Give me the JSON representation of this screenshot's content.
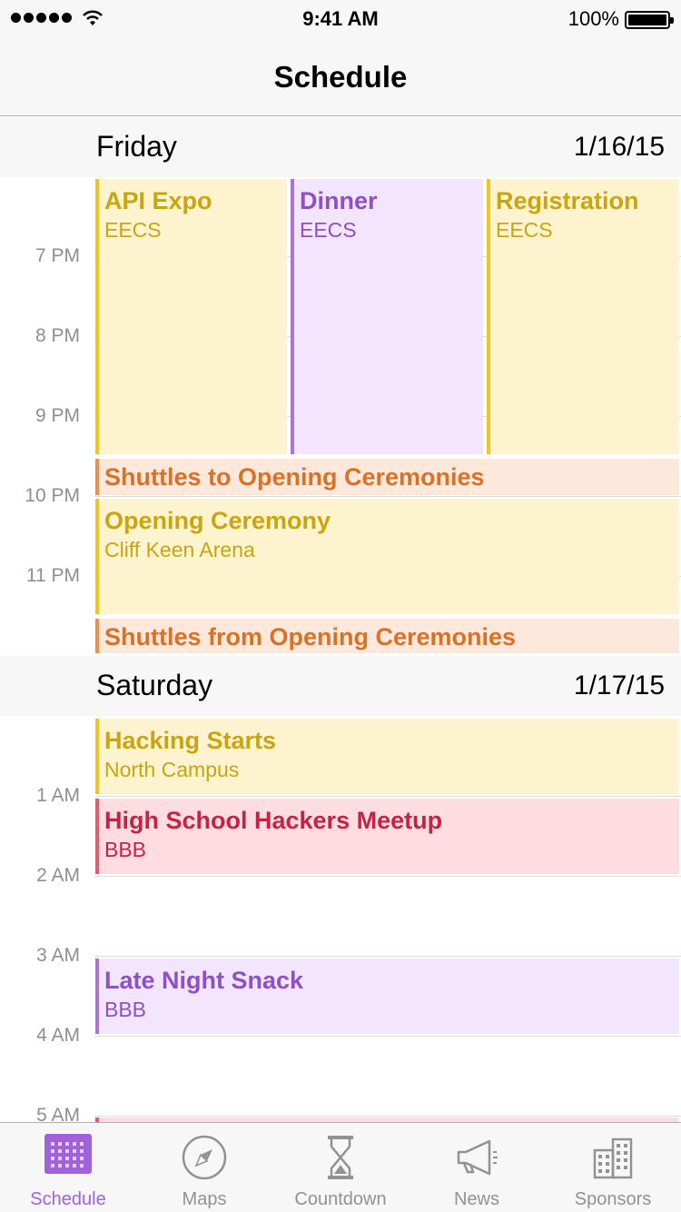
{
  "status_bar": {
    "time": "9:41 AM",
    "battery": "100%"
  },
  "nav": {
    "title": "Schedule"
  },
  "colors": {
    "yellow": "#f2c41f",
    "purple": "#a973d9",
    "orange": "#ee8f47",
    "pink": "#e55a73",
    "accent": "#a161d8"
  },
  "days": [
    {
      "name": "Friday",
      "date": "1/16/15",
      "hours": [
        "7 PM",
        "8 PM",
        "9 PM",
        "10 PM",
        "11 PM"
      ],
      "events": [
        {
          "title": "API Expo",
          "location": "EECS",
          "color": "yellow"
        },
        {
          "title": "Dinner",
          "location": "EECS",
          "color": "purple"
        },
        {
          "title": "Registration",
          "location": "EECS",
          "color": "yellow"
        },
        {
          "title": "Shuttles to Opening Ceremonies",
          "location": "",
          "color": "orange"
        },
        {
          "title": "Opening Ceremony",
          "location": "Cliff Keen Arena",
          "color": "yellow"
        },
        {
          "title": "Shuttles from Opening Ceremonies",
          "location": "",
          "color": "orange"
        }
      ]
    },
    {
      "name": "Saturday",
      "date": "1/17/15",
      "hours": [
        "1 AM",
        "2 AM",
        "3 AM",
        "4 AM",
        "5 AM"
      ],
      "events": [
        {
          "title": "Hacking Starts",
          "location": "North Campus",
          "color": "yellow"
        },
        {
          "title": "High School Hackers Meetup",
          "location": "BBB",
          "color": "pink"
        },
        {
          "title": "Late Night Snack",
          "location": "BBB",
          "color": "purple"
        }
      ]
    }
  ],
  "tabs": [
    {
      "label": "Schedule",
      "icon": "calendar-grid-icon",
      "active": true
    },
    {
      "label": "Maps",
      "icon": "compass-icon",
      "active": false
    },
    {
      "label": "Countdown",
      "icon": "hourglass-icon",
      "active": false
    },
    {
      "label": "News",
      "icon": "megaphone-icon",
      "active": false
    },
    {
      "label": "Sponsors",
      "icon": "building-icon",
      "active": false
    }
  ]
}
